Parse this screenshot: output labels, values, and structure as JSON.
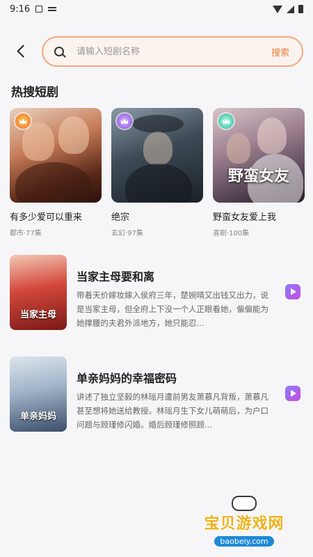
{
  "status_bar": {
    "time": "9:16"
  },
  "search": {
    "placeholder": "请输入短剧名称",
    "button_label": "搜索"
  },
  "hot_section": {
    "title": "热搜短剧",
    "items": [
      {
        "name": "有多少爱可以重来",
        "meta": "都市·77集",
        "badge_color": "#f06a2a",
        "cover_text": ""
      },
      {
        "name": "绝宗",
        "meta": "玄幻·97集",
        "badge_color": "#8a4ae0",
        "cover_text": ""
      },
      {
        "name": "野蛮女友爱上我",
        "meta": "喜剧·100集",
        "badge_color": "#2cb39a",
        "cover_text": "野蛮女友"
      }
    ]
  },
  "drama_list": [
    {
      "title": "当家主母要和离",
      "desc": "带着天价嫁妆嫁入侯府三年，楚婉晴又出钱又出力，说是当家主母，但全府上下没一个人正眼看她，偏偏能为她撑腰的夫君外派地方，她只能忍...",
      "cover_caption": "当家主母"
    },
    {
      "title": "单亲妈妈的幸福密码",
      "desc": "讲述了独立坚毅的林瑶月遭前男友萧慕凡背叛，萧慕凡甚至想将她送给教授。林瑶月生下女儿萌萌后，为户口问题与顾瑾修闪婚。婚后顾瑾修照顾...",
      "cover_caption": "单亲妈妈"
    }
  ],
  "watermark": {
    "text": "宝贝游戏网",
    "url": "baobeiy.com"
  },
  "colors": {
    "accent": "#f07d3c",
    "search_border": "#f5a57a",
    "play": "#9b6bf0"
  }
}
